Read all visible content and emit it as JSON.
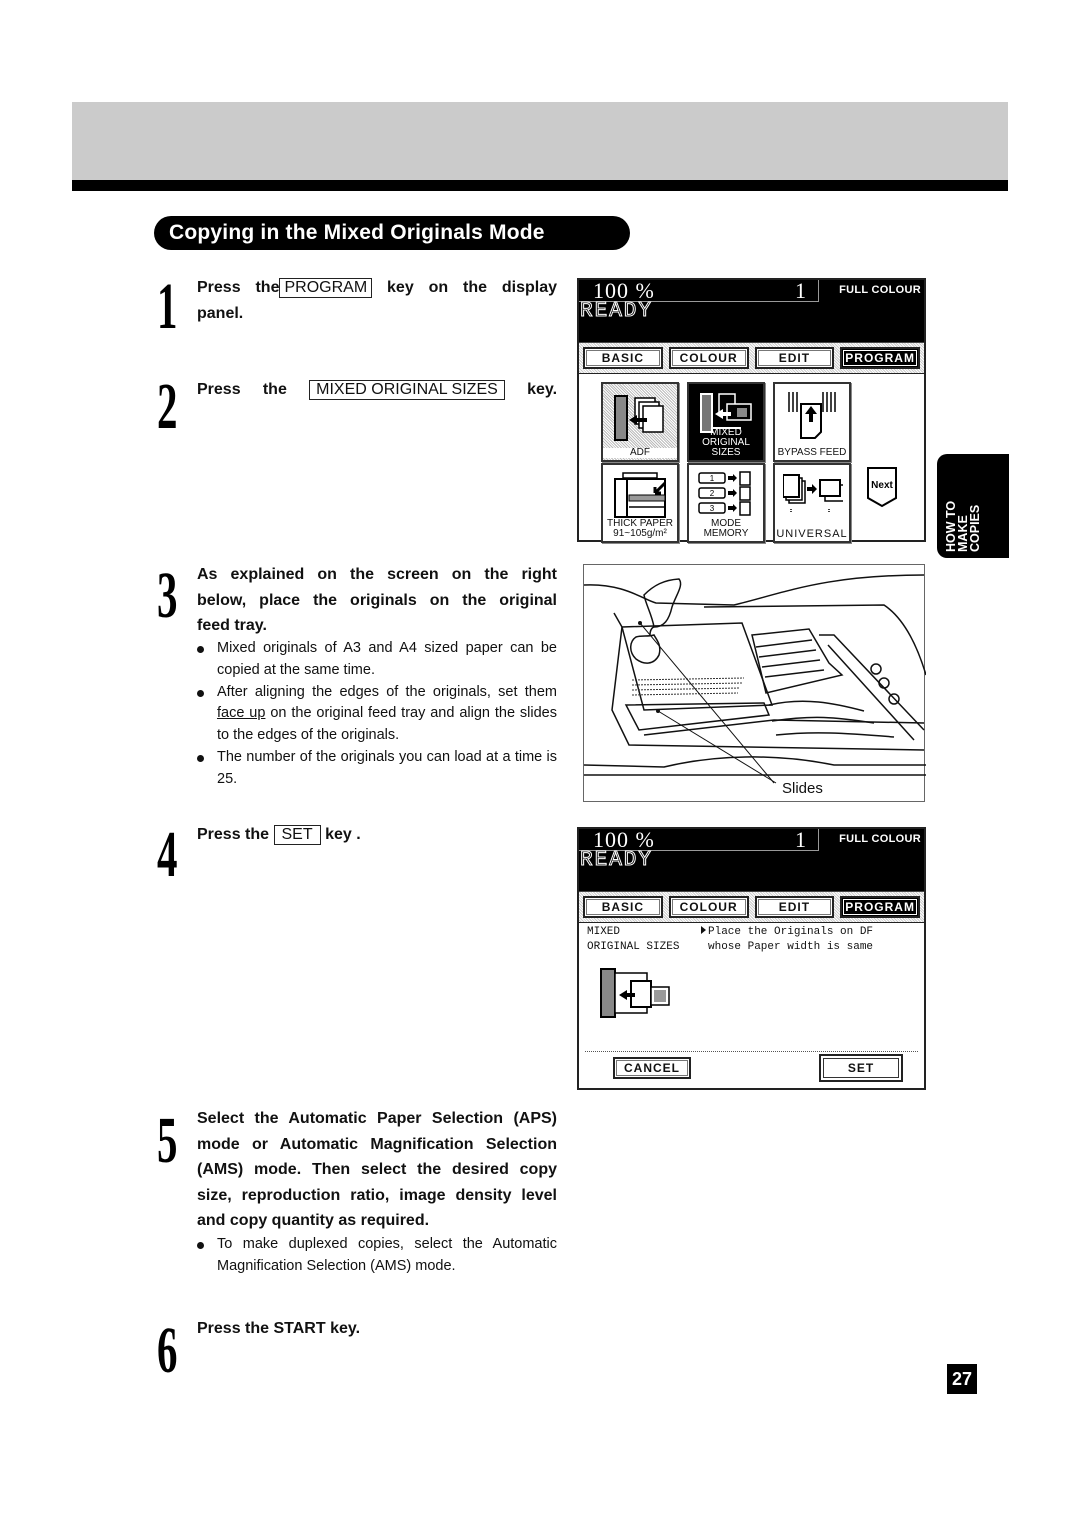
{
  "section_title": "Copying in the Mixed Originals Mode",
  "side_tab": {
    "label": "HOW TO\nMAKE\nCOPIES"
  },
  "page_number": "27",
  "steps": [
    {
      "number": "1",
      "lines": [
        "Press the",
        "PROGRAM",
        "key on the display",
        "panel."
      ]
    },
    {
      "number": "2",
      "prefix": "Press the",
      "key": "MIXED ORIGINAL SIZES",
      "suffix": "key."
    },
    {
      "number": "3",
      "lines": [
        "As explained on the screen on the right",
        "below, place the originals on the original",
        "feed tray."
      ],
      "bullets": [
        "Mixed originals of A3 and A4 sized paper can be copied at the same time.",
        {
          "before": "After aligning the edges of the originals, set them ",
          "underlined": "face up",
          "after": " on the original feed tray and align the slides to the edges of the originals."
        },
        "The number of the originals you can load at a time is 25."
      ]
    },
    {
      "number": "4",
      "prefix": "Press the",
      "key": "SET",
      "suffix": "key ."
    },
    {
      "number": "5",
      "lines": [
        "Select the Automatic Paper Selection (APS)",
        "mode or Automatic Magnification Selection",
        "(AMS) mode. Then select the desired copy",
        "size, reproduction ratio, image density level",
        "and copy quantity as required."
      ],
      "bullets": [
        "To make duplexed copies, select the Automatic Magnification Selection (AMS) mode."
      ]
    },
    {
      "number": "6",
      "text": "Press the START key."
    }
  ],
  "panel1": {
    "ratio": "100 %",
    "count": "1",
    "mode": "FULL COLOUR",
    "status": "READY",
    "tabs": [
      {
        "label": "BASIC",
        "active": false
      },
      {
        "label": "COLOUR",
        "active": false
      },
      {
        "label": "EDIT",
        "active": false
      },
      {
        "label": "PROGRAM",
        "active": true
      }
    ],
    "tiles": [
      {
        "label": "ADF",
        "icon": "adf-icon"
      },
      {
        "label": "MIXED ORIGINAL SIZES",
        "label_lines": [
          "MIXED",
          "ORIGINAL SIZES"
        ],
        "icon": "mixed-sizes-icon",
        "active": true
      },
      {
        "label": "BYPASS FEED",
        "icon": "bypass-feed-icon"
      },
      {
        "label": "THICK PAPER 91~105g/m²",
        "label_lines": [
          "THICK PAPER",
          "91~105g/m²"
        ],
        "icon": "thick-paper-icon"
      },
      {
        "label": "MODE MEMORY",
        "icon": "mode-memory-icon"
      },
      {
        "label": "UNIVERSAL",
        "icon": "universal-icon"
      }
    ],
    "next_label": "Next"
  },
  "illustration": {
    "callout": "Slides"
  },
  "panel2": {
    "ratio": "100 %",
    "count": "1",
    "mode": "FULL COLOUR",
    "status": "READY",
    "tabs": [
      {
        "label": "BASIC",
        "active": false
      },
      {
        "label": "COLOUR",
        "active": false
      },
      {
        "label": "EDIT",
        "active": false
      },
      {
        "label": "PROGRAM",
        "active": true
      }
    ],
    "function_name_lines": [
      "MIXED",
      "ORIGINAL SIZES"
    ],
    "message_lines": [
      "Place the Originals on DF",
      "whose Paper width is same"
    ],
    "cancel_label": "CANCEL",
    "set_label": "SET"
  }
}
